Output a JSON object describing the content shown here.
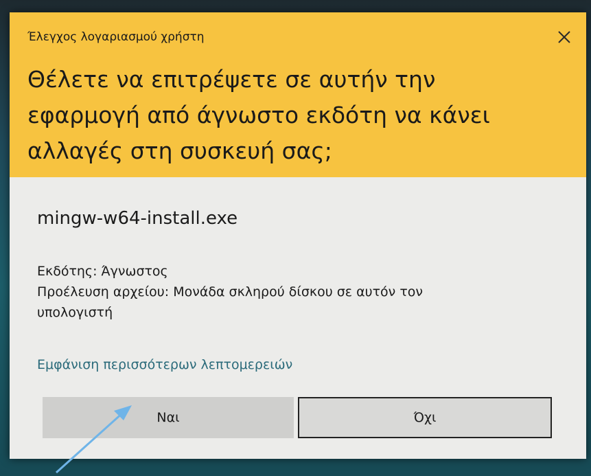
{
  "dialog": {
    "title": "Έλεγχος λογαριασμού χρήστη",
    "question_line1": "Θέλετε να επιτρέψετε σε αυτήν την",
    "question_line2": "εφαρμογή από άγνωστο εκδότη να κάνει",
    "question_line3": "αλλαγές στη συσκευή σας;",
    "app_name": "mingw-w64-install.exe",
    "publisher": "Εκδότης: Άγνωστος",
    "origin_line1": "Προέλευση αρχείου: Μονάδα σκληρού δίσκου σε αυτόν τον",
    "origin_line2": "υπολογιστή",
    "more_details_link": "Εμφάνιση περισσότερων λεπτομερειών",
    "yes_button": "Ναι",
    "no_button": "Όχι",
    "close_icon": "close-icon"
  },
  "colors": {
    "header_bg": "#f7c340",
    "body_bg": "#ececea",
    "link": "#2a6a7a",
    "arrow": "#6fb4e8"
  }
}
